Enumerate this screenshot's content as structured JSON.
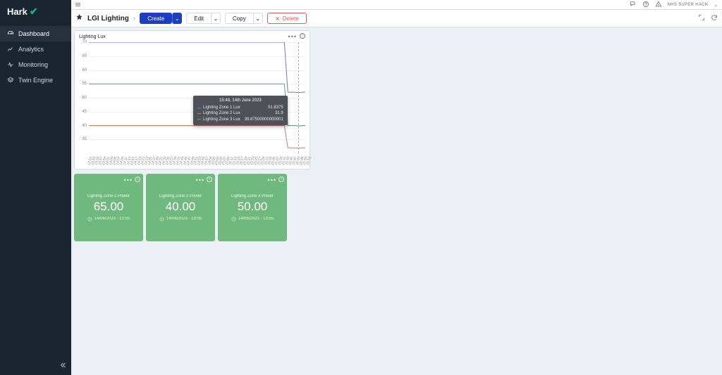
{
  "brand": "Hark",
  "topbar": {
    "user": "NHS SUPER HACK"
  },
  "sidebar": {
    "items": [
      {
        "label": "Dashboard"
      },
      {
        "label": "Analytics"
      },
      {
        "label": "Monitoring"
      },
      {
        "label": "Twin Engine"
      }
    ]
  },
  "header": {
    "page_title": "LGI Lighting",
    "create_label": "Create",
    "edit_label": "Edit",
    "copy_label": "Copy",
    "delete_label": "Delete"
  },
  "chart_card": {
    "title": "Lighting Lux"
  },
  "chart_data": {
    "type": "line",
    "title": "Lighting Lux",
    "xlabel": "",
    "ylabel": "",
    "ylim": [
      30,
      70
    ],
    "x": [
      "13:51",
      "13:53",
      "13:55",
      "13:57",
      "13:59",
      "14:01",
      "14:03",
      "14:05",
      "14:07",
      "14:09",
      "14:11",
      "14:13",
      "14:15",
      "14:17",
      "14:19",
      "14:21",
      "14:23",
      "14:25",
      "14:27",
      "14:29",
      "14:31",
      "14:33",
      "14:35",
      "14:37",
      "14:39",
      "14:41",
      "14:43",
      "14:45",
      "14:47",
      "14:49",
      "14:51",
      "14:53",
      "14:55",
      "14:57",
      "14:59",
      "15:01",
      "15:03",
      "15:05",
      "15:07",
      "15:09",
      "15:11",
      "15:13",
      "15:15",
      "15:17",
      "15:19",
      "15:21",
      "15:23",
      "15:25",
      "15:27",
      "15:29",
      "15:31",
      "15:33",
      "15:35",
      "15:37",
      "15:39",
      "15:41",
      "15:43",
      "15:45",
      "15:47",
      "15:49",
      "15:48",
      "15:50",
      "15:52"
    ],
    "series": [
      {
        "name": "Lighting Zone 1 Lux",
        "color": "#6a79d7",
        "values": [
          70,
          70,
          70,
          70,
          70,
          70,
          70,
          70,
          70,
          70,
          70,
          70,
          70,
          70,
          70,
          70,
          70,
          70,
          70,
          70,
          70,
          70,
          70,
          70,
          70,
          70,
          70,
          70,
          70,
          70,
          70,
          70,
          70,
          70,
          70,
          70,
          70,
          70,
          70,
          70,
          70,
          70,
          70,
          70,
          70,
          70,
          70,
          70,
          70,
          70,
          70,
          70,
          70,
          70,
          70,
          70,
          70,
          52,
          52,
          52,
          51.8375,
          52,
          52
        ]
      },
      {
        "name": "Lighting Zone 2 Lux",
        "color": "#d07c6b",
        "values": [
          40,
          40,
          40,
          40,
          40,
          40,
          40,
          40,
          40,
          40,
          40,
          40,
          40,
          40,
          40,
          40,
          40,
          40,
          40,
          40,
          40,
          40,
          40,
          40,
          40,
          40,
          40,
          40,
          40,
          40,
          40,
          40,
          40,
          40,
          40,
          40,
          40,
          40,
          40,
          40,
          40,
          40,
          40,
          40,
          40,
          40,
          40,
          40,
          40,
          40,
          40,
          40,
          40,
          40,
          40,
          40,
          40,
          32,
          32,
          32,
          31.9,
          32,
          32
        ]
      },
      {
        "name": "Lighting Zone 3 Lux",
        "color": "#5aa071",
        "values": [
          55,
          55,
          55,
          55,
          55,
          55,
          55,
          55,
          55,
          55,
          55,
          55,
          55,
          55,
          55,
          55,
          55,
          55,
          55,
          55,
          55,
          55,
          55,
          55,
          55,
          55,
          55,
          55,
          55,
          55,
          55,
          55,
          55,
          55,
          55,
          55,
          55,
          55,
          55,
          55,
          55,
          55,
          55,
          55,
          55,
          55,
          55,
          55,
          55,
          55,
          55,
          55,
          55,
          55,
          55,
          55,
          55,
          40,
          40,
          40,
          39.875,
          40,
          40
        ]
      }
    ],
    "tooltip": {
      "time_label": "15:48, 14th June 2023",
      "rows": [
        {
          "label": "Lighting Zone 1 Lux",
          "value": "51.8375",
          "color": "#6a79d7"
        },
        {
          "label": "Lighting Zone 2 Lux",
          "value": "31.9",
          "color": "#d07c6b"
        },
        {
          "label": "Lighting Zone 3 Lux",
          "value": "39.87500000000001",
          "color": "#5aa071"
        }
      ]
    }
  },
  "cards": [
    {
      "title": "Lighting Zone 1 Power",
      "value": "65.00",
      "timestamp": "14/06/2023 - 13:55"
    },
    {
      "title": "Lighting Zone 2 Power",
      "value": "40.00",
      "timestamp": "14/06/2023 - 13:55"
    },
    {
      "title": "Lighting Zone 3 Power",
      "value": "50.00",
      "timestamp": "14/06/2023 - 13:55"
    }
  ]
}
